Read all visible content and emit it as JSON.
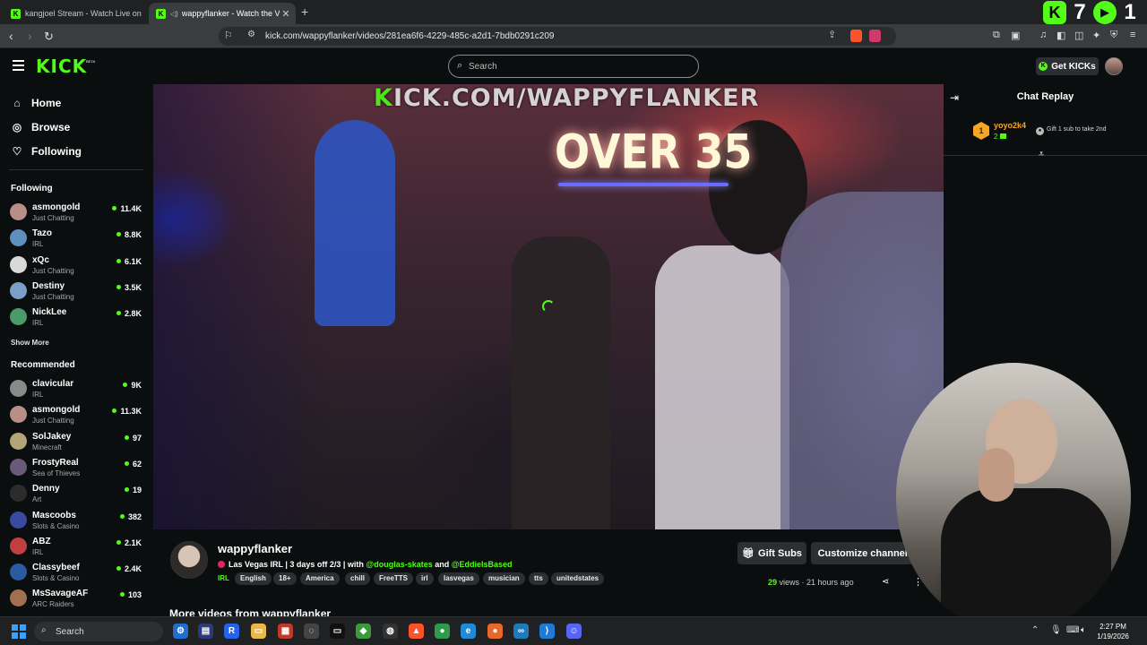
{
  "browser": {
    "tabs": [
      {
        "title": "kangjoel Stream - Watch Live on"
      },
      {
        "title": "wappyflanker - Watch the VO"
      }
    ],
    "url": "kick.com/wappyflanker/videos/281ea6f6-4229-485c-a2d1-7bdb0291c209",
    "overlay": {
      "first": "7",
      "second": "1"
    }
  },
  "header": {
    "logo": "KICK",
    "logo_badge": "BETA",
    "search_placeholder": "Search",
    "get_kicks": "Get KICKs"
  },
  "sidebar": {
    "nav": [
      {
        "label": "Home",
        "icon": "home-icon"
      },
      {
        "label": "Browse",
        "icon": "compass-icon"
      },
      {
        "label": "Following",
        "icon": "heart-icon"
      }
    ],
    "following_title": "Following",
    "following": [
      {
        "name": "asmongold",
        "category": "Just Chatting",
        "viewers": "11.4K",
        "color": "#b98e86"
      },
      {
        "name": "Tazo",
        "category": "IRL",
        "viewers": "8.8K",
        "color": "#5f8fbf"
      },
      {
        "name": "xQc",
        "category": "Just Chatting",
        "viewers": "6.1K",
        "color": "#d8d8d8"
      },
      {
        "name": "Destiny",
        "category": "Just Chatting",
        "viewers": "3.5K",
        "color": "#7aa0c8"
      },
      {
        "name": "NickLee",
        "category": "IRL",
        "viewers": "2.8K",
        "color": "#4a9a6a"
      }
    ],
    "show_more": "Show More",
    "recommended_title": "Recommended",
    "recommended": [
      {
        "name": "clavicular",
        "category": "IRL",
        "viewers": "9K",
        "color": "#8a8a8a"
      },
      {
        "name": "asmongold",
        "category": "Just Chatting",
        "viewers": "11.3K",
        "color": "#b98e86"
      },
      {
        "name": "SolJakey",
        "category": "Minecraft",
        "viewers": "97",
        "color": "#b4a47a"
      },
      {
        "name": "FrostyReal",
        "category": "Sea of Thieves",
        "viewers": "62",
        "color": "#6a5a7a"
      },
      {
        "name": "Denny",
        "category": "Art",
        "viewers": "19",
        "color": "#2c2c2c"
      },
      {
        "name": "Mascoobs",
        "category": "Slots & Casino",
        "viewers": "382",
        "color": "#3a4aa0"
      },
      {
        "name": "ABZ",
        "category": "IRL",
        "viewers": "2.1K",
        "color": "#c04040"
      },
      {
        "name": "Classybeef",
        "category": "Slots & Casino",
        "viewers": "2.4K",
        "color": "#2a5aa0"
      },
      {
        "name": "MsSavageAF",
        "category": "ARC Raiders",
        "viewers": "103",
        "color": "#a07050"
      }
    ]
  },
  "video": {
    "watermark_k": "K",
    "watermark_rest": "ICK.COM/WAPPYFLANKER",
    "sign_text": "OVER 35"
  },
  "chat": {
    "title": "Chat Replay",
    "gifter_rank": "1",
    "gifter_name": "yoyo2k4",
    "gifter_count": "2",
    "gift_prompt": "Gift 1 sub to take 2nd"
  },
  "info": {
    "channel_name": "wappyflanker",
    "title_prefix": "Las Vegas IRL | 3 days off 2/3 | with ",
    "mention1": "@douglas-skates",
    "title_and": " and ",
    "mention2": "@EddieIsBased",
    "category": "IRL",
    "tags": [
      "English",
      "18+",
      "America",
      "chill",
      "FreeTTS",
      "irl",
      "lasvegas",
      "musician",
      "tts",
      "unitedstates"
    ],
    "gift_subs": "Gift Subs",
    "customize": "Customize channel",
    "views_count": "29",
    "views_label": " views",
    "time_ago": "21 hours ago",
    "more_videos": "More videos from wappyflanker"
  },
  "taskbar": {
    "search_placeholder": "Search",
    "time": "2:27 PM",
    "date": "1/19/2026"
  },
  "colors": {
    "accent": "#53fc18",
    "bg": "#0b0e0f",
    "panel": "#2b2f31"
  }
}
